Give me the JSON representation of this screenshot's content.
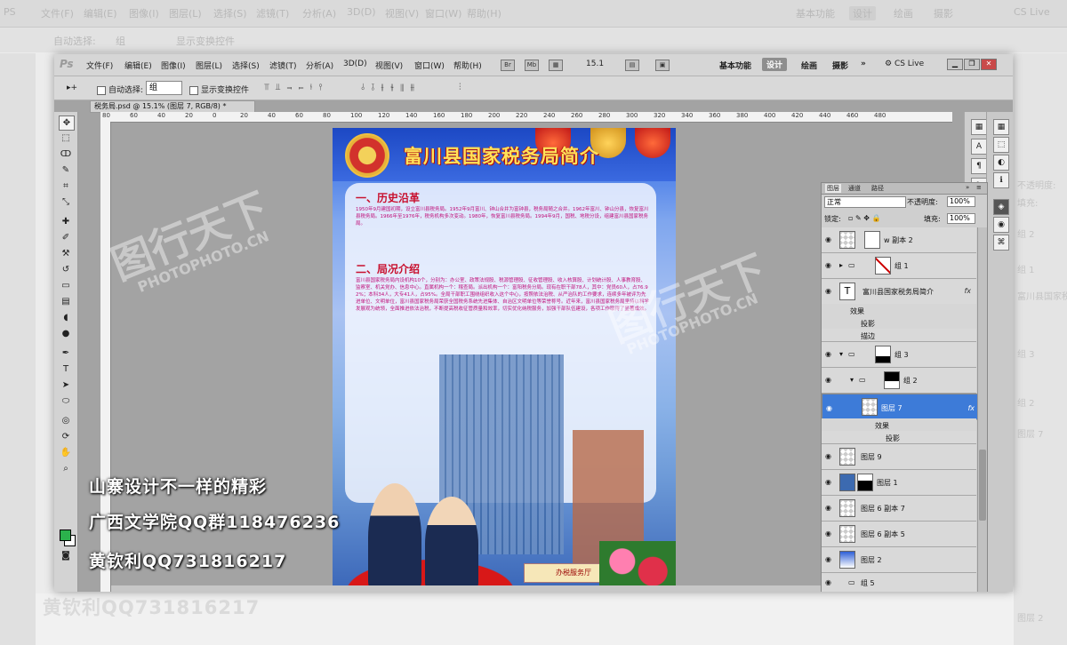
{
  "menu": {
    "app_logo": "Ps",
    "items": [
      "文件(F)",
      "编辑(E)",
      "图像(I)",
      "图层(L)",
      "选择(S)",
      "滤镜(T)",
      "分析(A)",
      "3D(D)",
      "视图(V)",
      "窗口(W)",
      "帮助(H)"
    ],
    "icons": [
      "Br",
      "Mb"
    ],
    "zoom": "15.1",
    "workspaces": [
      "基本功能",
      "设计",
      "绘画",
      "摄影"
    ],
    "active_workspace": "设计",
    "more": "»",
    "cs_live": "CS Live"
  },
  "options": {
    "tool_glyph": "▸+",
    "auto_select_label": "自动选择:",
    "auto_select_value": "组",
    "show_transform_label": "显示变换控件",
    "align_glyphs": "⫪ ⫫ ⫬ ⫭ ⫮ ⫯",
    "distribute_glyphs": "⫰ ⫱ ⫲ ⫳ ⫴ ⫵",
    "arrange_glyph": "⫶"
  },
  "document_tab": "税务局.psd @ 15.1% (图层 7, RGB/8) *",
  "ruler_ticks": [
    "80",
    "60",
    "40",
    "20",
    "0",
    "20",
    "40",
    "60",
    "80",
    "100",
    "120",
    "140",
    "160",
    "180",
    "200",
    "220",
    "240",
    "260",
    "280",
    "300",
    "320",
    "340",
    "360",
    "380",
    "400",
    "420",
    "440",
    "460",
    "480"
  ],
  "poster": {
    "title": "富川县国家税务局简介",
    "section1": "一、历史沿革",
    "section1_text": "1950年9月建国初期，设立富川县税务局。1952年9月富川、钟山合并为富钟县，税务局随之合并。1962年富川、钟山分县，恢复富川县税务局。1966年至1976年，税务机构多次变动。1980年，恢复富川县税务局。1994年9月，国税、地税分设，组建富川县国家税务局。",
    "section2": "二、局况介绍",
    "section2_text": "富川县国家税务局内设机构10个，分别为：办公室、政策法规股、税源管理股、征收管理股、收入核算股、计划统计股、人事教育股、监察室、机关党办、信息中心。直属机构一个：稽查局。派出机构一个：富阳税务分局。现有在职干部78人，其中：党员60人，占76.92%；本科34人，大专41人，占95%。全局干部职工围绕组织收入这个中心，按照依法治税、从严治队的工作要求，连续多年被评为先进单位、文明单位，富川县国家税务局荣获全国税务系统先进集体、自治区文明单位等荣誉称号。近年来，富川县国家税务局坚持以科学发展观为统领，全面推进依法治税，不断提高税收征管质量和效率，切实优化纳税服务，加强干部队伍建设，各项工作取得了显著成效。",
    "sign": "办税服务厅"
  },
  "watermark": {
    "script": "图行天下",
    "url": "PHOTOPHOTO.CN"
  },
  "overlay": {
    "line1": "山寨设计不一样的精彩",
    "line2": "广西文学院QQ群118476236",
    "line3": "黄钦利QQ731816217"
  },
  "layers_panel": {
    "tabs": [
      "图层",
      "通道",
      "路径"
    ],
    "blend_mode": "正常",
    "opacity_label": "不透明度:",
    "opacity_value": "100%",
    "lock_label": "锁定:",
    "fill_label": "填充:",
    "fill_value": "100%",
    "layers": [
      {
        "name": "w 副本 2"
      },
      {
        "name": "组 1"
      },
      {
        "name": "富川县国家税务局简介",
        "fx": "fx"
      },
      {
        "name": "效果"
      },
      {
        "name": "投影"
      },
      {
        "name": "描边"
      },
      {
        "name": "组 3"
      },
      {
        "name": "组 2"
      },
      {
        "name": "图层 7",
        "fx": "fx"
      },
      {
        "name": "效果"
      },
      {
        "name": "投影"
      },
      {
        "name": "图层 9"
      },
      {
        "name": "图层 1"
      },
      {
        "name": "图层 6 副本 7"
      },
      {
        "name": "图层 6 副本 5"
      },
      {
        "name": "图层 2"
      },
      {
        "name": "组 5"
      }
    ]
  },
  "background_ghost": {
    "topbar": [
      "PS",
      "文件(F)",
      "编辑(E)",
      "图像(I)",
      "图层(L)",
      "选择(S)",
      "滤镜(T)",
      "分析(A)",
      "3D(D)",
      "视图(V)",
      "窗口(W)",
      "帮助(H)",
      "基本功能",
      "设计",
      "绘画",
      "摄影",
      "CS Live"
    ],
    "options": [
      "自动选择:",
      "组",
      "显示变换控件"
    ],
    "right": [
      "不透明度:",
      "填充:",
      "组 2",
      "组 1",
      "富川县国家税务局简介",
      "组 3",
      "组 2",
      "图层 7",
      "图层 2"
    ],
    "bottom": "黄钦利QQ731816217"
  },
  "colors": {
    "selected_layer": "#3d7bd8",
    "poster_title": "#ffe35a",
    "section_title": "#c8102e",
    "body_text": "#c0107a",
    "fg_color": "#2bb24c"
  }
}
